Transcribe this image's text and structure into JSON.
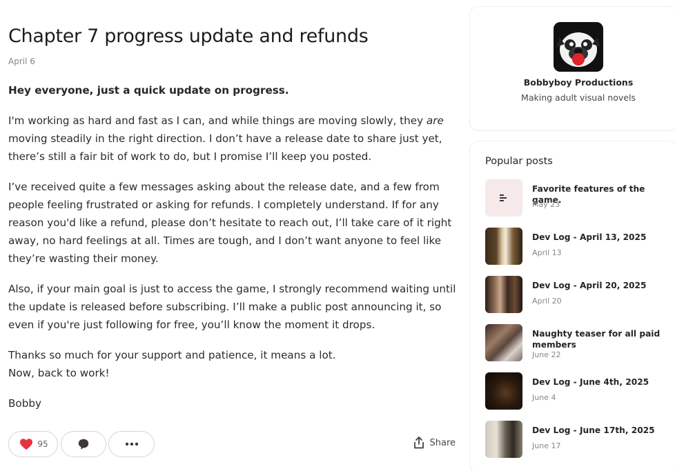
{
  "post": {
    "title": "Chapter 7 progress update and refunds",
    "date": "April 6",
    "lead": "Hey everyone, just a quick update on progress.",
    "p1_before": "I'm working as hard and fast as I can, and while things are moving slowly, they ",
    "p1_em": "are",
    "p1_after": " moving steadily in the right direction. I don’t have a release date to share just yet, there’s still a fair bit of work to do, but I promise I’ll keep you posted.",
    "p2": "I’ve received quite a few messages asking about the release date, and a few from people feeling frustrated or asking for refunds. I completely understand. If for any reason you'd like a refund, please don’t hesitate to reach out, I’ll take care of it right away, no hard feelings at all. Times are tough, and I don’t want anyone to feel like they’re wasting their money.",
    "p3": "Also, if your main goal is just to access the game, I strongly recommend waiting until the update is released before subscribing. I’ll make a public post announcing it, so even if you're just following for free, you’ll know the moment it drops.",
    "p4_line1": "Thanks so much for your support and patience, it means a lot.",
    "p4_line2": "Now, back to work!",
    "signoff": "Bobby"
  },
  "actions": {
    "like_count": "95",
    "share_label": "Share"
  },
  "creator": {
    "name": "Bobbyboy Productions",
    "tagline": "Making adult visual novels"
  },
  "popular": {
    "title": "Popular posts",
    "items": [
      {
        "title": "Favorite features of the game.",
        "date": "May 23",
        "thumb": "text-post-icon"
      },
      {
        "title": "Dev Log - April 13, 2025",
        "date": "April 13",
        "thumb": "image"
      },
      {
        "title": "Dev Log - April 20, 2025",
        "date": "April 20",
        "thumb": "image"
      },
      {
        "title": "Naughty teaser for all paid members",
        "date": "June 22",
        "thumb": "image"
      },
      {
        "title": "Dev Log - June 4th, 2025",
        "date": "June 4",
        "thumb": "image"
      },
      {
        "title": "Dev Log - June 17th, 2025",
        "date": "June 17",
        "thumb": "image"
      }
    ]
  },
  "colors": {
    "heart": "#e5343f",
    "text_thumb_bg": "#f5e9ea"
  }
}
